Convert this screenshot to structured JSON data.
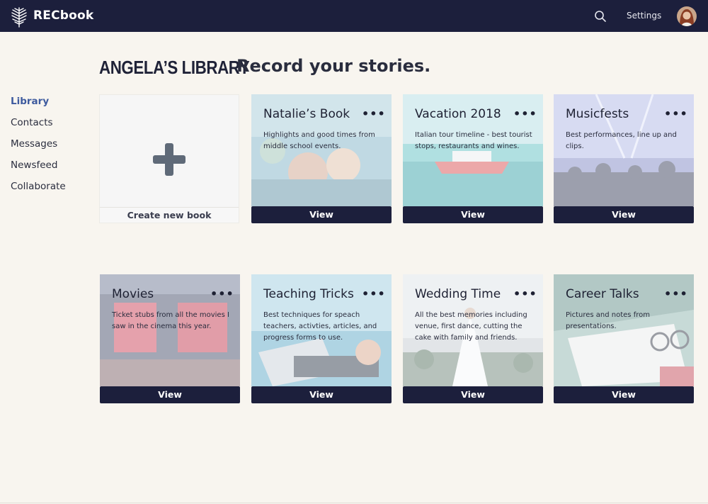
{
  "app": {
    "brand": "RECbook",
    "logo_icon": "feather-icon",
    "topbar_color": "#1c1f3c"
  },
  "header": {
    "search_icon": "search-icon",
    "settings_label": "Settings",
    "avatar_icon": "user-avatar"
  },
  "sidebar": {
    "items": [
      {
        "label": "Library",
        "active": true
      },
      {
        "label": "Contacts",
        "active": false
      },
      {
        "label": "Messages",
        "active": false
      },
      {
        "label": "Newsfeed",
        "active": false
      },
      {
        "label": "Collaborate",
        "active": false
      }
    ]
  },
  "main": {
    "title": "ANGELA’S LIBRARY",
    "subtitle": "Record your stories.",
    "create_label": "Create new book",
    "more_glyph": "•••",
    "books": [
      {
        "title": "Natalie’s Book",
        "description": "Highlights and good times from middle school events.",
        "view_label": "View",
        "image_icon": "photo-friends-icon"
      },
      {
        "title": "Vacation 2018",
        "description": "Italian tour timeline - best tourist stops, restaurants and wines.",
        "view_label": "View",
        "image_icon": "photo-boat-icon"
      },
      {
        "title": "Musicfests",
        "description": "Best performances, line up and clips.",
        "view_label": "View",
        "image_icon": "photo-concert-icon"
      },
      {
        "title": "Movies",
        "description": "Ticket stubs from all the movies I saw in the cinema this year.",
        "view_label": "View",
        "image_icon": "photo-cinema-icon"
      },
      {
        "title": "Teaching Tricks",
        "description": "Best techniques for speach teachers, activties, articles, and progress forms to use.",
        "view_label": "View",
        "image_icon": "photo-laptop-icon"
      },
      {
        "title": "Wedding Time",
        "description": "All the best memories including venue, first dance, cutting the cake with family and friends.",
        "view_label": "View",
        "image_icon": "photo-wedding-icon"
      },
      {
        "title": "Career Talks",
        "description": "Pictures and notes from presentations.",
        "view_label": "View",
        "image_icon": "photo-desk-icon"
      }
    ]
  }
}
